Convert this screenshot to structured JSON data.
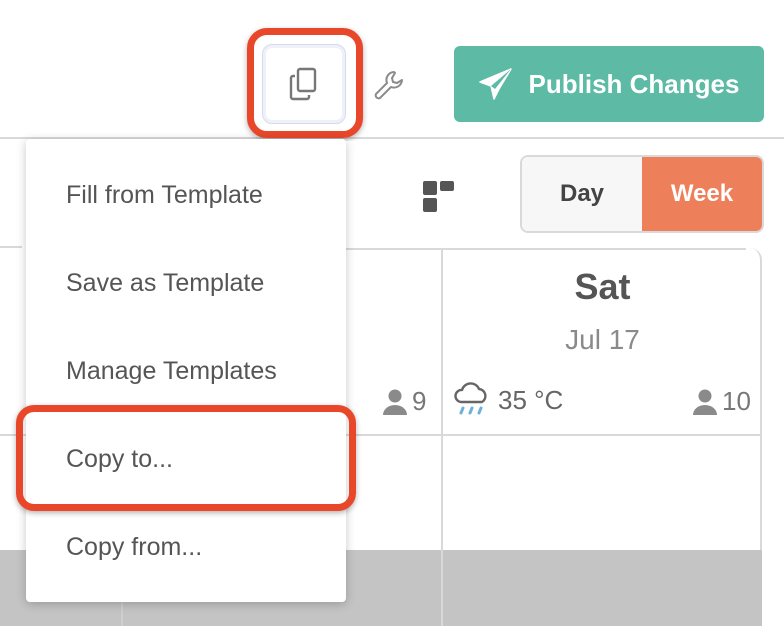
{
  "toolbar": {
    "copy_icon": "copy-icon",
    "wrench_icon": "wrench-icon",
    "publish_label": "Publish Changes",
    "publish_icon": "paper-plane-icon",
    "publish_color": "#5cbaa5"
  },
  "view": {
    "day_label": "Day",
    "week_label": "Week",
    "active": "Week",
    "active_color": "#ee7f5b",
    "grid_icon": "grid-icon"
  },
  "calendar": {
    "prev_column": {
      "staff_count": "9"
    },
    "sat": {
      "day": "Sat",
      "date": "Jul 17",
      "weather_icon": "rain-cloud-icon",
      "temperature": "35 °C",
      "staff_count": "10"
    }
  },
  "menu": {
    "items": [
      {
        "label": "Fill from Template"
      },
      {
        "label": "Save as Template"
      },
      {
        "label": "Manage Templates"
      },
      {
        "label": "Copy to..."
      },
      {
        "label": "Copy from..."
      }
    ]
  },
  "highlight_color": "#e8472a"
}
